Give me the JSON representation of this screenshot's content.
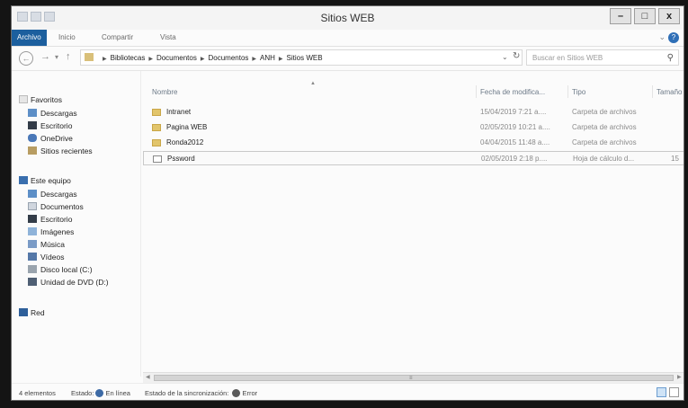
{
  "window": {
    "title": "Sitios WEB",
    "controls": {
      "minimize": "–",
      "maximize": "□",
      "close": "x"
    }
  },
  "ribbon": {
    "tabs": [
      "Archivo",
      "Inicio",
      "Compartir",
      "Vista"
    ],
    "help_label": "?"
  },
  "address": {
    "breadcrumbs": [
      "Bibliotecas",
      "Documentos",
      "Documentos",
      "ANH",
      "Sitios WEB"
    ],
    "search_placeholder": "Buscar en Sitios WEB"
  },
  "sidebar": {
    "favorites_label": "Favoritos",
    "favorites": [
      "Descargas",
      "Escritorio",
      "OneDrive",
      "Sitios recientes"
    ],
    "pc_label": "Este equipo",
    "pc_items": [
      "Descargas",
      "Documentos",
      "Escritorio",
      "Imágenes",
      "Música",
      "Vídeos",
      "Disco local (C:)",
      "Unidad de DVD (D:)"
    ],
    "network_label": "Red"
  },
  "columns": {
    "name": "Nombre",
    "date": "Fecha de modifica...",
    "type": "Tipo",
    "size": "Tamaño"
  },
  "files": [
    {
      "name": "Intranet",
      "date": "15/04/2019 7:21 a....",
      "type": "Carpeta de archivos",
      "size": "",
      "icon": "folder"
    },
    {
      "name": "Pagina WEB",
      "date": "02/05/2019 10:21 a....",
      "type": "Carpeta de archivos",
      "size": "",
      "icon": "folder"
    },
    {
      "name": "Ronda2012",
      "date": "04/04/2015 11:48 a....",
      "type": "Carpeta de archivos",
      "size": "",
      "icon": "folder"
    },
    {
      "name": "Pssword",
      "date": "02/05/2019 2:18 p....",
      "type": "Hoja de cálculo d...",
      "size": "15",
      "icon": "spreadsheet"
    }
  ],
  "status": {
    "count": "4 elementos",
    "state_label": "Estado:",
    "state_value": "En línea",
    "sync_label": "Estado de la sincronización:",
    "sync_value": "Error"
  },
  "colors": {
    "ribbon_active": "#1c5f9e",
    "folder": "#e2c56b",
    "frame": "#141414"
  }
}
